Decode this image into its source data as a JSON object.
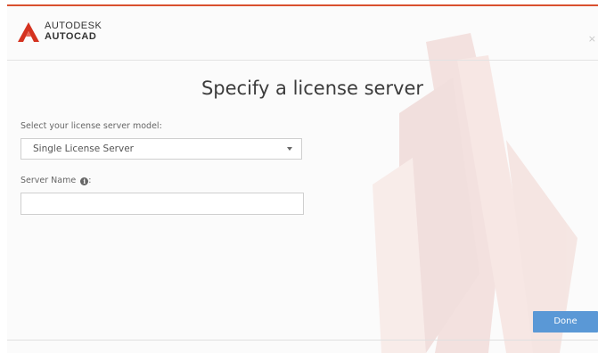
{
  "window": {
    "brand_top": "AUTODESK",
    "brand_bottom": "AUTOCAD",
    "close_glyph": "×"
  },
  "main": {
    "title": "Specify a license server",
    "model_label": "Select your license server model:",
    "model_selected": "Single License Server",
    "server_name_label": "Server Name",
    "server_name_suffix": ":",
    "server_name_value": ""
  },
  "footer": {
    "done_label": "Done"
  },
  "colors": {
    "accent": "#d9502f",
    "button": "#5a98d6"
  }
}
